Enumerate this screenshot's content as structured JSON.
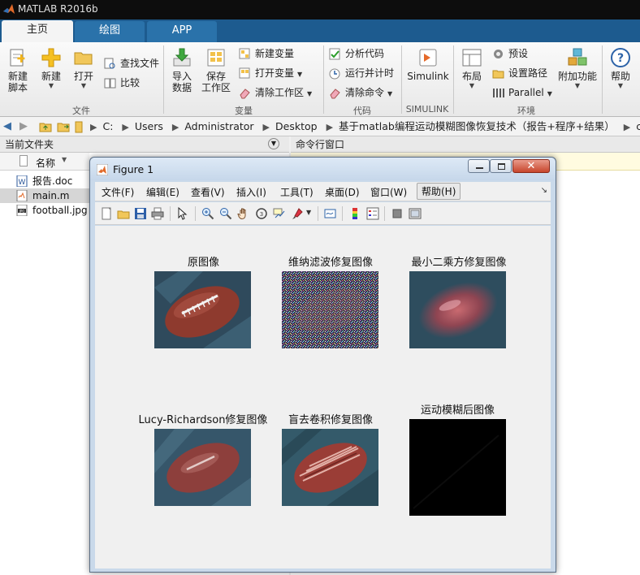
{
  "app": {
    "title": "MATLAB R2016b"
  },
  "tabs": [
    {
      "label": "主页"
    },
    {
      "label": "绘图"
    },
    {
      "label": "APP"
    }
  ],
  "ribbon": {
    "new_script": "新建\n脚本",
    "new_script_l1": "新建",
    "new_script_l2": "脚本",
    "new": "新建",
    "open": "打开",
    "find_files": "查找文件",
    "compare": "比较",
    "import_l1": "导入",
    "import_l2": "数据",
    "save_ws_l1": "保存",
    "save_ws_l2": "工作区",
    "new_var": "新建变量",
    "open_var": "打开变量",
    "clear_ws": "清除工作区",
    "analyze_code": "分析代码",
    "run_time": "运行并计时",
    "clear_cmd": "清除命令",
    "simulink": "Simulink",
    "layout": "布局",
    "prefs": "预设",
    "set_path": "设置路径",
    "parallel": "Parallel",
    "addons": "附加功能",
    "help": "帮助",
    "groups": {
      "file": "文件",
      "variable": "变量",
      "code": "代码",
      "simulink": "SIMULINK",
      "env": "环境"
    }
  },
  "address": {
    "crumbs": [
      "C:",
      "Users",
      "Administrator",
      "Desktop",
      "基于matlab编程运动模糊图像恢复技术（报告+程序+结果）",
      "code"
    ]
  },
  "panels": {
    "current_folder": "当前文件夹",
    "command_window": "命令行窗口",
    "name_col": "名称"
  },
  "files": [
    {
      "name": "报告.doc"
    },
    {
      "name": "main.m"
    },
    {
      "name": "football.jpg"
    }
  ],
  "figure": {
    "title": "Figure 1",
    "menu": [
      "文件(F)",
      "编辑(E)",
      "查看(V)",
      "插入(I)",
      "工具(T)",
      "桌面(D)",
      "窗口(W)",
      "帮助(H)"
    ],
    "subplots": [
      {
        "title": "原图像"
      },
      {
        "title": "维纳滤波修复图像"
      },
      {
        "title": "最小二乘方修复图像"
      },
      {
        "title": "Lucy-Richardson修复图像"
      },
      {
        "title": "盲去卷积修复图像"
      },
      {
        "title": "运动模糊后图像"
      }
    ]
  },
  "colors": {
    "tab_bar": "#1d5b8f",
    "window_bg": "#f0f0f0",
    "titlebar": "#0d0d0d"
  }
}
